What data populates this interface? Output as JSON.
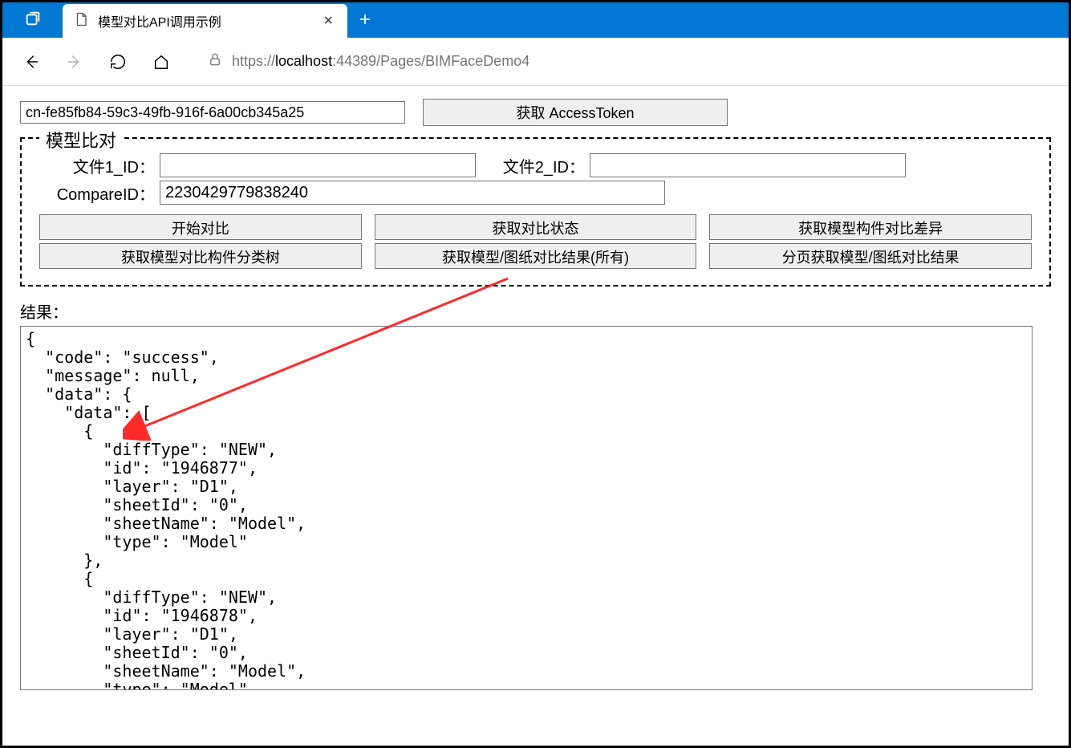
{
  "window": {
    "tab_title": "模型对比API调用示例"
  },
  "url": {
    "prefix": "https://",
    "host": "localhost",
    "rest": ":44389/Pages/BIMFaceDemo4"
  },
  "top": {
    "token_value": "cn-fe85fb84-59c3-49fb-916f-6a00cb345a25",
    "get_token_btn": "获取 AccessToken"
  },
  "fieldset": {
    "legend": "模型比对",
    "file1_label": "文件1_ID：",
    "file1_value": "",
    "file2_label": "文件2_ID：",
    "file2_value": "",
    "compareid_label": "CompareID：",
    "compareid_value": "2230429779838240",
    "buttons": {
      "start": "开始对比",
      "status": "获取对比状态",
      "element_diff": "获取模型构件对比差异",
      "tree": "获取模型对比构件分类树",
      "all_results": "获取模型/图纸对比结果(所有)",
      "paged_results": "分页获取模型/图纸对比结果"
    }
  },
  "result": {
    "label": "结果：",
    "text": "{\n  \"code\": \"success\",\n  \"message\": null,\n  \"data\": {\n    \"data\": [\n      {\n        \"diffType\": \"NEW\",\n        \"id\": \"1946877\",\n        \"layer\": \"D1\",\n        \"sheetId\": \"0\",\n        \"sheetName\": \"Model\",\n        \"type\": \"Model\"\n      },\n      {\n        \"diffType\": \"NEW\",\n        \"id\": \"1946878\",\n        \"layer\": \"D1\",\n        \"sheetId\": \"0\",\n        \"sheetName\": \"Model\",\n        \"type\": \"Model\""
  }
}
